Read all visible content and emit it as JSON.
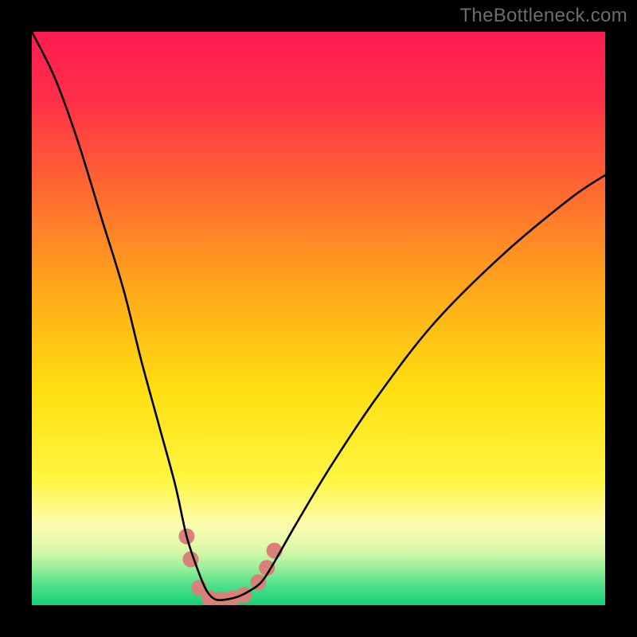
{
  "watermark": "TheBottleneck.com",
  "chart_data": {
    "type": "line",
    "title": "",
    "xlabel": "",
    "ylabel": "",
    "xlim": [
      0,
      100
    ],
    "ylim": [
      0,
      100
    ],
    "grid": false,
    "legend": false,
    "gradient_stops": [
      {
        "offset": 0.0,
        "color": "#ff1b52"
      },
      {
        "offset": 0.12,
        "color": "#ff3048"
      },
      {
        "offset": 0.28,
        "color": "#ff6a30"
      },
      {
        "offset": 0.45,
        "color": "#ffa81a"
      },
      {
        "offset": 0.62,
        "color": "#ffde10"
      },
      {
        "offset": 0.78,
        "color": "#fff640"
      },
      {
        "offset": 0.86,
        "color": "#fdfcb0"
      },
      {
        "offset": 0.905,
        "color": "#d8f8a8"
      },
      {
        "offset": 0.935,
        "color": "#9aef9a"
      },
      {
        "offset": 0.965,
        "color": "#4fe08a"
      },
      {
        "offset": 1.0,
        "color": "#18cf7a"
      }
    ],
    "series": [
      {
        "name": "bottleneck-curve",
        "x": [
          0,
          4,
          8,
          12,
          16,
          19,
          22,
          25,
          27,
          29,
          30.5,
          32,
          34,
          36,
          38,
          40,
          42,
          46,
          52,
          60,
          70,
          82,
          94,
          100
        ],
        "values": [
          100,
          92,
          81,
          68,
          55,
          43,
          32,
          21,
          12,
          6,
          2.5,
          1,
          1,
          1.5,
          2.5,
          4,
          7,
          14,
          24,
          36,
          49,
          61,
          71,
          75
        ]
      }
    ],
    "markers": {
      "name": "bottleneck-markers",
      "color": "#d98078",
      "radius_px": 10,
      "points": [
        {
          "x": 27.0,
          "y": 12.0
        },
        {
          "x": 27.7,
          "y": 8.0
        },
        {
          "x": 29.2,
          "y": 3.0
        },
        {
          "x": 31.0,
          "y": 1.2
        },
        {
          "x": 33.0,
          "y": 1.0
        },
        {
          "x": 35.0,
          "y": 1.2
        },
        {
          "x": 37.0,
          "y": 1.8
        },
        {
          "x": 39.5,
          "y": 4.0
        },
        {
          "x": 41.0,
          "y": 6.5
        },
        {
          "x": 42.3,
          "y": 9.5
        }
      ]
    }
  }
}
